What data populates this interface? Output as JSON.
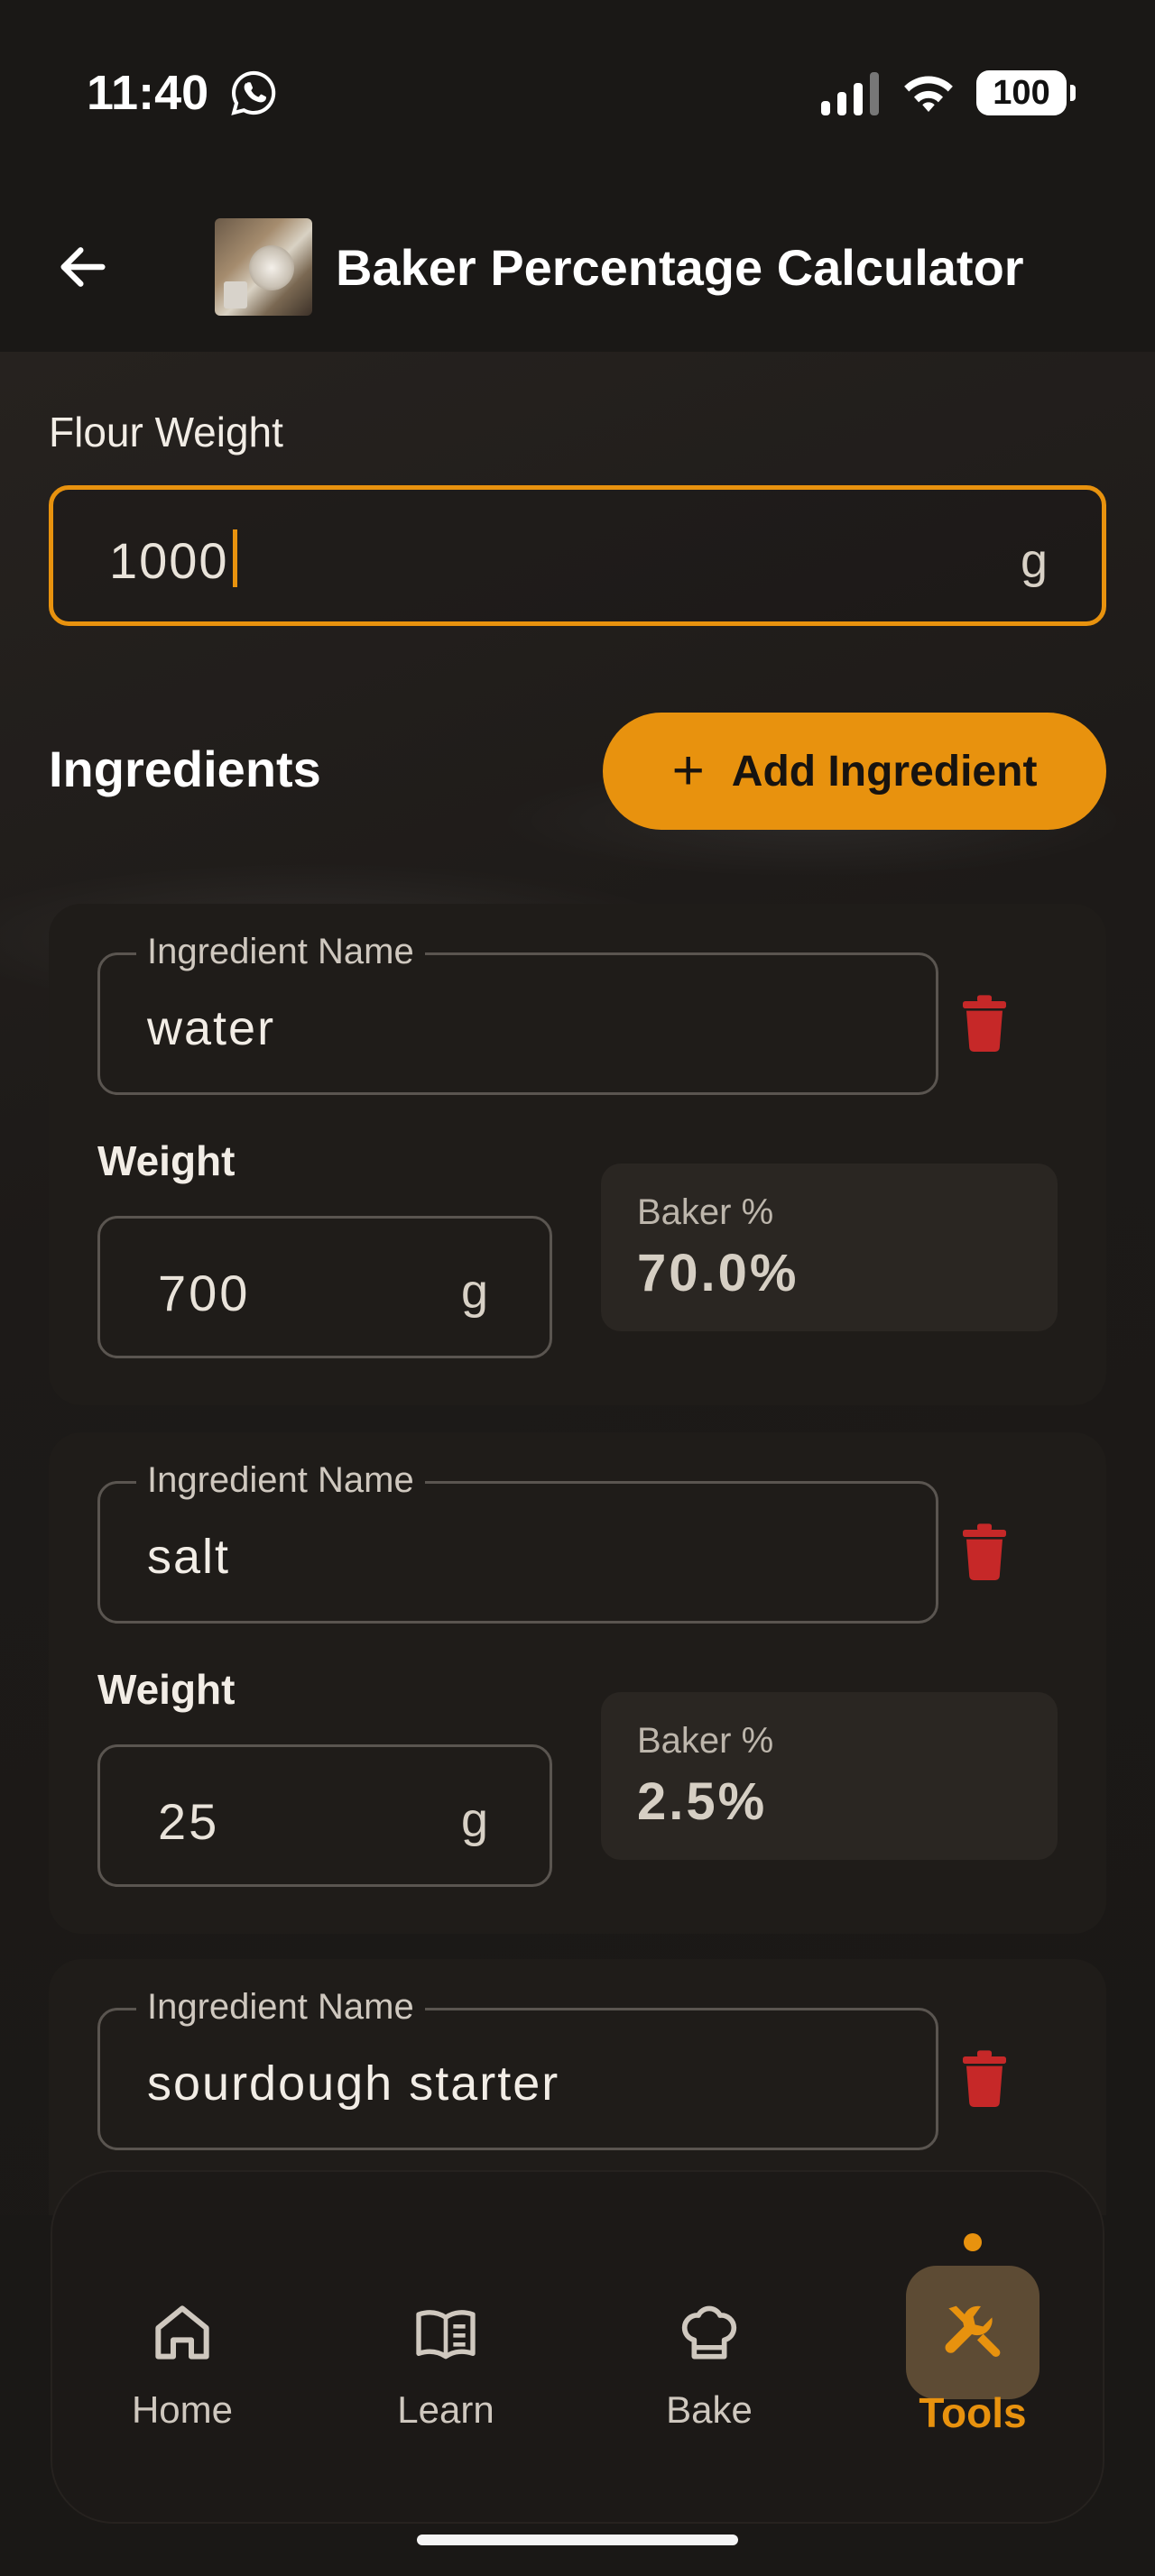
{
  "status_bar": {
    "time": "11:40",
    "battery": "100",
    "icons": [
      "whatsapp-icon",
      "signal-icon",
      "wifi-icon",
      "battery-icon"
    ]
  },
  "app_bar": {
    "title": "Baker Percentage Calculator",
    "back_icon": "arrow-left-icon",
    "thumbnail": "kitchen-scale-thumbnail"
  },
  "flour": {
    "label": "Flour Weight",
    "value": "1000",
    "unit": "g"
  },
  "ingredients_section": {
    "title": "Ingredients",
    "add_button_label": "Add Ingredient",
    "add_icon": "plus-icon"
  },
  "ingredients": [
    {
      "name_label": "Ingredient Name",
      "name": "water",
      "weight_label": "Weight",
      "weight": "700",
      "unit": "g",
      "pct_label": "Baker %",
      "pct": "70.0%"
    },
    {
      "name_label": "Ingredient Name",
      "name": "salt",
      "weight_label": "Weight",
      "weight": "25",
      "unit": "g",
      "pct_label": "Baker %",
      "pct": "2.5%"
    },
    {
      "name_label": "Ingredient Name",
      "name": "sourdough starter"
    }
  ],
  "nav": {
    "items": [
      {
        "label": "Home",
        "icon": "home-icon"
      },
      {
        "label": "Learn",
        "icon": "book-icon"
      },
      {
        "label": "Bake",
        "icon": "chef-hat-icon"
      },
      {
        "label": "Tools",
        "icon": "tools-icon",
        "active": true
      }
    ]
  },
  "colors": {
    "accent": "#e8920e",
    "background": "#1a1816",
    "card": "#1f1c19",
    "delete": "#c62828"
  }
}
